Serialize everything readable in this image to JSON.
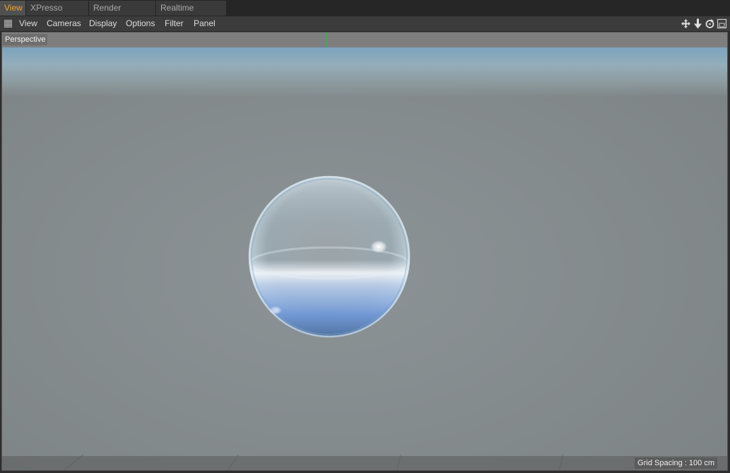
{
  "tabs": [
    {
      "label": "View",
      "active": true
    },
    {
      "label": "XPresso Editor",
      "active": false
    },
    {
      "label": "Render Settings",
      "active": false
    },
    {
      "label": "Realtime Preview",
      "active": false
    }
  ],
  "menu": {
    "items": [
      "View",
      "Cameras",
      "Display",
      "Options",
      "Filter",
      "Panel"
    ]
  },
  "nav_icons": [
    "move-view-icon",
    "dolly-view-icon",
    "rotate-view-icon",
    "toggle-layout-icon"
  ],
  "viewport": {
    "camera_label": "Perspective",
    "grid_spacing": "Grid Spacing : 100 cm"
  },
  "colors": {
    "active_tab_text": "#f3a431",
    "viewport_bg": "#858c8e",
    "axis_y": "#34b34a"
  }
}
